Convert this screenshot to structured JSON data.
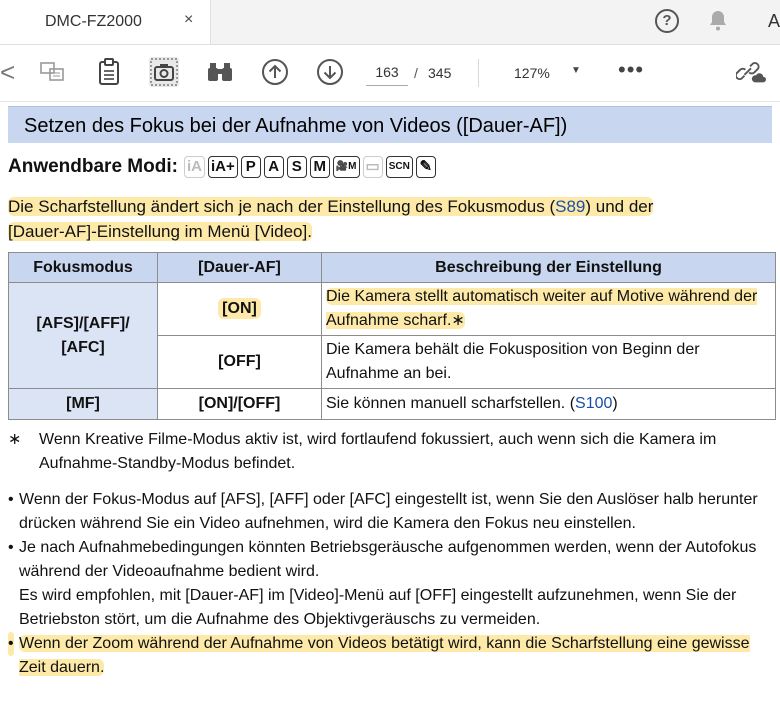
{
  "tab": {
    "title": "DMC-FZ2000",
    "close": "×"
  },
  "topbar": {
    "help": "?",
    "account_initial": "A"
  },
  "toolbar": {
    "back": "<",
    "page_current": "163",
    "page_sep": "/",
    "page_total": "345",
    "zoom": "127%",
    "zoom_caret": "▼",
    "more": "•••",
    "icons": [
      "thumbnail-icon",
      "clipboard-icon",
      "camera-icon",
      "binoculars-icon",
      "up-arrow-icon",
      "down-arrow-icon",
      "cloud-link-icon"
    ]
  },
  "doc": {
    "title": "Setzen des Fokus bei der Aufnahme von Videos ([Dauer-AF])",
    "modes_label": "Anwendbare Modi:",
    "modes": [
      {
        "label": "iA",
        "dim": true
      },
      {
        "label": "iA+",
        "dim": false
      },
      {
        "label": "P",
        "dim": false
      },
      {
        "label": "A",
        "dim": false
      },
      {
        "label": "S",
        "dim": false
      },
      {
        "label": "M",
        "dim": false
      },
      {
        "label": "🎥M",
        "dim": false
      },
      {
        "label": "▭",
        "dim": true
      },
      {
        "label": "SCN",
        "dim": false
      },
      {
        "label": "✎",
        "dim": false
      }
    ],
    "intro_a": "Die Scharfstellung ändert sich je nach der Einstellung des Fokusmodus (",
    "intro_link": "S89",
    "intro_b": ") und der",
    "intro_c": "[Dauer-AF]-Einstellung im Menü [Video].",
    "table": {
      "headers": [
        "Fokusmodus",
        "[Dauer-AF]",
        "Beschreibung der Einstellung"
      ],
      "row1_mode": "[AFS]/[AFF]/ [AFC]",
      "row1_on": "[ON]",
      "row1_on_desc": "Die Kamera stellt automatisch weiter auf Motive während der Aufnahme scharf.∗",
      "row1_off": "[OFF]",
      "row1_off_desc": "Die Kamera behält die Fokusposition von Beginn der Aufnahme an bei.",
      "row2_mode": "[MF]",
      "row2_val": "[ON]/[OFF]",
      "row2_desc": "Sie können manuell scharfstellen. (",
      "row2_link": "S100",
      "row2_desc_end": ")"
    },
    "footnote_mark": "∗",
    "footnote": "Wenn Kreative Filme-Modus aktiv ist, wird fortlaufend fokussiert, auch wenn sich die Kamera im Aufnahme-Standby-Modus befindet.",
    "bullet_dot": "•",
    "bullet1": "Wenn der Fokus-Modus auf [AFS], [AFF] oder [AFC] eingestellt ist, wenn Sie den Auslöser halb herunter drücken während Sie ein Video aufnehmen, wird die Kamera den Fokus neu einstellen.",
    "bullet2_a": "Je nach Aufnahmebedingungen könnten Betriebsgeräusche aufgenommen werden, wenn der Autofokus während der Videoaufnahme bedient wird.",
    "bullet2_b": "Es wird empfohlen, mit [Dauer-AF] im [Video]-Menü auf [OFF] eingestellt aufzunehmen, wenn Sie der Betriebston stört, um die Aufnahme des Objektivgeräuschs zu vermeiden.",
    "bullet3": "Wenn der Zoom während der Aufnahme von Videos betätigt wird, kann die Scharfstellung eine gewisse Zeit dauern."
  },
  "colors": {
    "title_bg": "#c9d6ef",
    "highlight": "#fde9a8",
    "link": "#1a4ea8"
  }
}
